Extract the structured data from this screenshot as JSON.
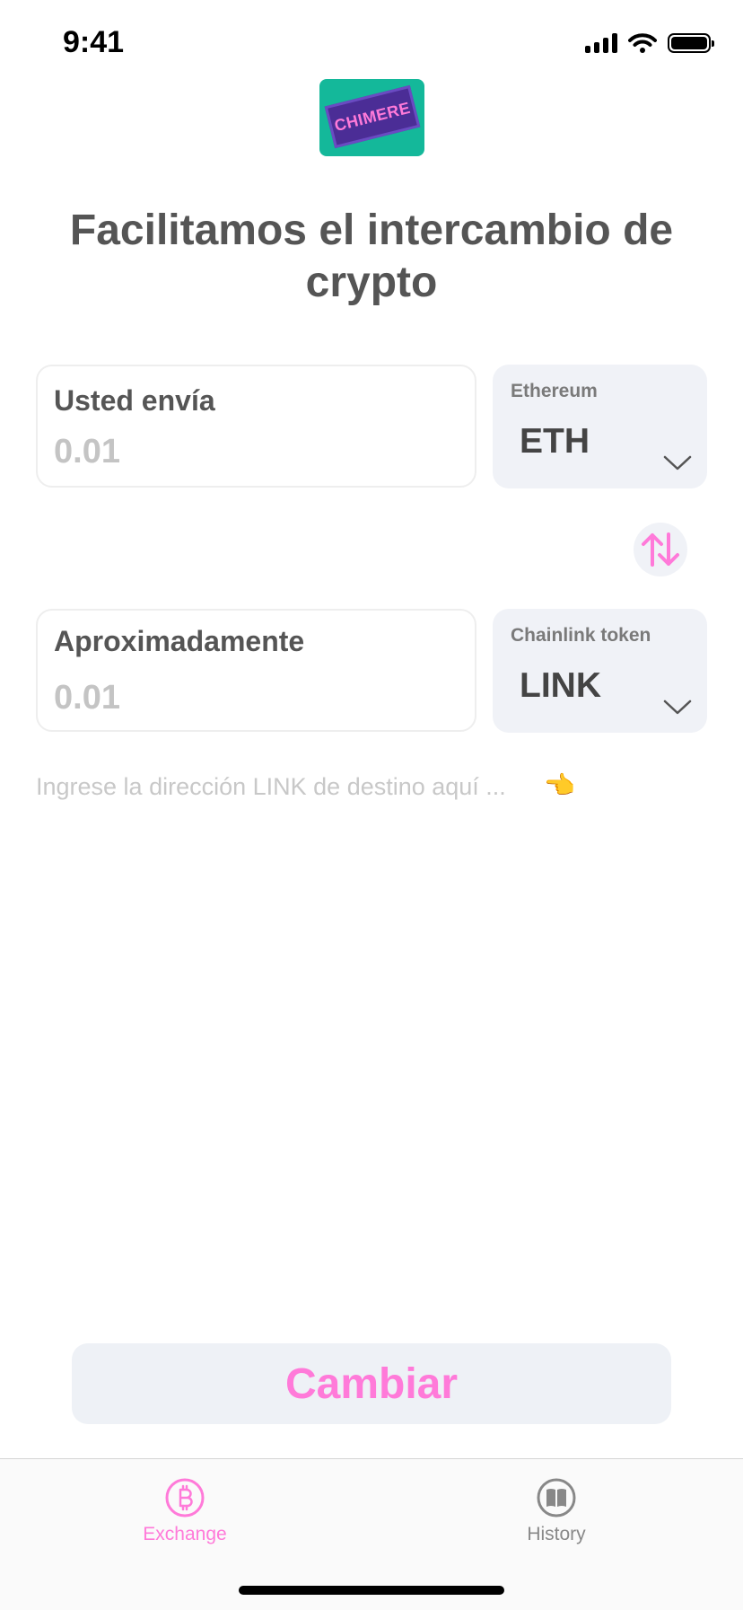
{
  "status_bar": {
    "time": "9:41"
  },
  "logo": {
    "text": "CHIMERE"
  },
  "headline": "Facilitamos el intercambio de crypto",
  "send": {
    "label": "Usted envía",
    "placeholder": "0.01",
    "value": "",
    "coin_name": "Ethereum",
    "coin_symbol": "ETH"
  },
  "receive": {
    "label": "Aproximadamente",
    "placeholder": "0.01",
    "value": "",
    "coin_name": "Chainlink token",
    "coin_symbol": "LINK"
  },
  "address": {
    "placeholder": "Ingrese la dirección LINK de destino aquí ...",
    "pointer_emoji": "👈"
  },
  "submit_label": "Cambiar",
  "tabs": [
    {
      "label": "Exchange",
      "icon": "bitcoin-icon",
      "active": true
    },
    {
      "label": "History",
      "icon": "book-icon",
      "active": false
    }
  ],
  "colors": {
    "accent": "#ff7ad9",
    "inactive": "#888888",
    "text": "#555555",
    "select_bg": "#f0f2f7",
    "logo_bg": "#14b89a"
  }
}
